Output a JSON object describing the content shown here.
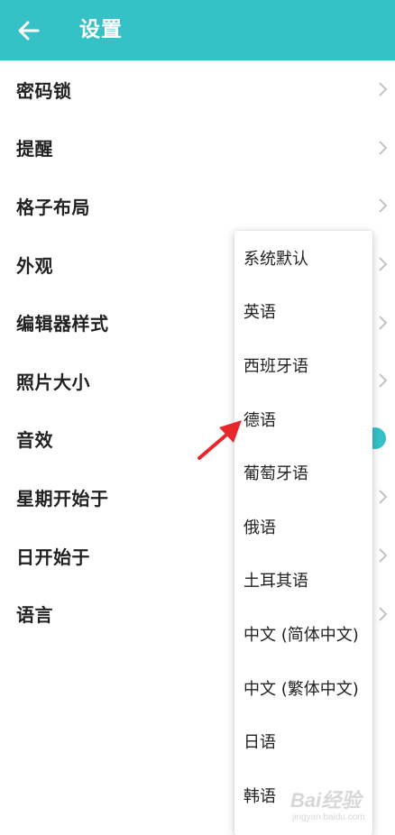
{
  "header": {
    "title": "设置",
    "back_icon": "arrow-left-icon"
  },
  "settings": {
    "items": [
      {
        "label": "密码锁"
      },
      {
        "label": "提醒"
      },
      {
        "label": "格子布局"
      },
      {
        "label": "外观"
      },
      {
        "label": "编辑器样式"
      },
      {
        "label": "照片大小"
      },
      {
        "label": "音效"
      },
      {
        "label": "星期开始于"
      },
      {
        "label": "日开始于"
      },
      {
        "label": "语言"
      }
    ]
  },
  "language_menu": {
    "options": [
      {
        "label": "系统默认"
      },
      {
        "label": "英语"
      },
      {
        "label": "西班牙语"
      },
      {
        "label": "德语"
      },
      {
        "label": "葡萄牙语"
      },
      {
        "label": "俄语"
      },
      {
        "label": "土耳其语"
      },
      {
        "label": "中文 (简体中文)"
      },
      {
        "label": "中文 (繁体中文)"
      },
      {
        "label": "日语"
      },
      {
        "label": "韩语"
      }
    ]
  },
  "annotation": {
    "arrow_color": "#e8262b",
    "points_to": "德语"
  },
  "watermark": {
    "brand": "Bai经验",
    "url": "jingyan.baidu.com"
  },
  "colors": {
    "accent": "#35c2c7",
    "text": "#222222",
    "chevron": "#bdbdbd"
  }
}
